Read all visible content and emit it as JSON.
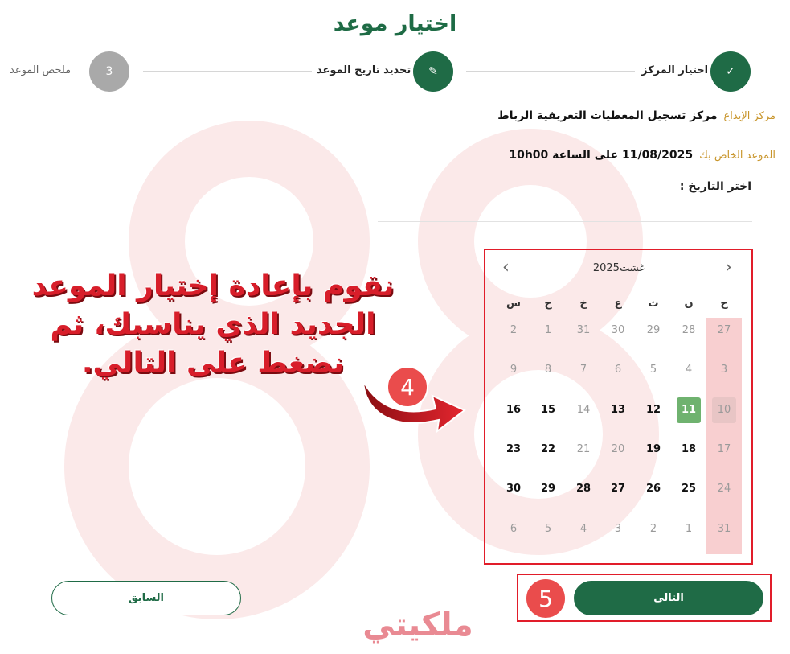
{
  "page": {
    "title": "اختيار موعد"
  },
  "stepper": {
    "steps": [
      {
        "label": "اختيار المركز",
        "symbol": "✓"
      },
      {
        "label": "تحديد تاريخ الموعد",
        "symbol": "✎"
      },
      {
        "label": "ملخص الموعد",
        "symbol": "3"
      }
    ]
  },
  "info": {
    "center_label": "مركز الإيداع",
    "center_value": "مركز تسجيل المعطيات التعريفية الرباط",
    "appointment_label": "الموعد الخاص بك",
    "appointment_value": "11/08/2025 على الساعة 10h00"
  },
  "date_picker": {
    "label": "اختر التاريخ :"
  },
  "calendar": {
    "month_label": "غشت2025",
    "prev_icon": "chevron-left-icon",
    "next_icon": "chevron-right-icon",
    "weekdays": [
      "ح",
      "ن",
      "ث",
      "ع",
      "خ",
      "ج",
      "س"
    ],
    "weeks": [
      [
        {
          "d": "27",
          "s": "muted"
        },
        {
          "d": "28",
          "s": "muted"
        },
        {
          "d": "29",
          "s": "muted"
        },
        {
          "d": "30",
          "s": "muted"
        },
        {
          "d": "31",
          "s": "muted"
        },
        {
          "d": "1",
          "s": "muted"
        },
        {
          "d": "2",
          "s": "muted"
        }
      ],
      [
        {
          "d": "3",
          "s": "muted"
        },
        {
          "d": "4",
          "s": "muted"
        },
        {
          "d": "5",
          "s": "muted"
        },
        {
          "d": "6",
          "s": "muted"
        },
        {
          "d": "7",
          "s": "muted"
        },
        {
          "d": "8",
          "s": "muted"
        },
        {
          "d": "9",
          "s": "muted"
        }
      ],
      [
        {
          "d": "10",
          "s": "today"
        },
        {
          "d": "11",
          "s": "selected"
        },
        {
          "d": "12",
          "s": "available"
        },
        {
          "d": "13",
          "s": "available"
        },
        {
          "d": "14",
          "s": "muted"
        },
        {
          "d": "15",
          "s": "available"
        },
        {
          "d": "16",
          "s": "available"
        }
      ],
      [
        {
          "d": "17",
          "s": "muted"
        },
        {
          "d": "18",
          "s": "available"
        },
        {
          "d": "19",
          "s": "available"
        },
        {
          "d": "20",
          "s": "muted"
        },
        {
          "d": "21",
          "s": "muted"
        },
        {
          "d": "22",
          "s": "available"
        },
        {
          "d": "23",
          "s": "available"
        }
      ],
      [
        {
          "d": "24",
          "s": "muted"
        },
        {
          "d": "25",
          "s": "available"
        },
        {
          "d": "26",
          "s": "available"
        },
        {
          "d": "27",
          "s": "available"
        },
        {
          "d": "28",
          "s": "available"
        },
        {
          "d": "29",
          "s": "available"
        },
        {
          "d": "30",
          "s": "available"
        }
      ],
      [
        {
          "d": "31",
          "s": "muted"
        },
        {
          "d": "1",
          "s": "muted"
        },
        {
          "d": "2",
          "s": "muted"
        },
        {
          "d": "3",
          "s": "muted"
        },
        {
          "d": "4",
          "s": "muted"
        },
        {
          "d": "5",
          "s": "muted"
        },
        {
          "d": "6",
          "s": "muted"
        }
      ]
    ]
  },
  "annotation": {
    "text_line1": "نقوم بإعادة إختيار الموعد",
    "text_line2": "الجديد الذي يناسبك، ثم",
    "text_line3": "نضغط على التالي.",
    "badge_calendar": "4",
    "badge_next": "5"
  },
  "buttons": {
    "next": "التالي",
    "previous": "السابق"
  },
  "brand": {
    "logo_text": "ملكيتي"
  },
  "colors": {
    "primary": "#1f6b46",
    "accent": "#c8952b",
    "highlight": "#e11d2a",
    "selected": "#6fb26f"
  }
}
